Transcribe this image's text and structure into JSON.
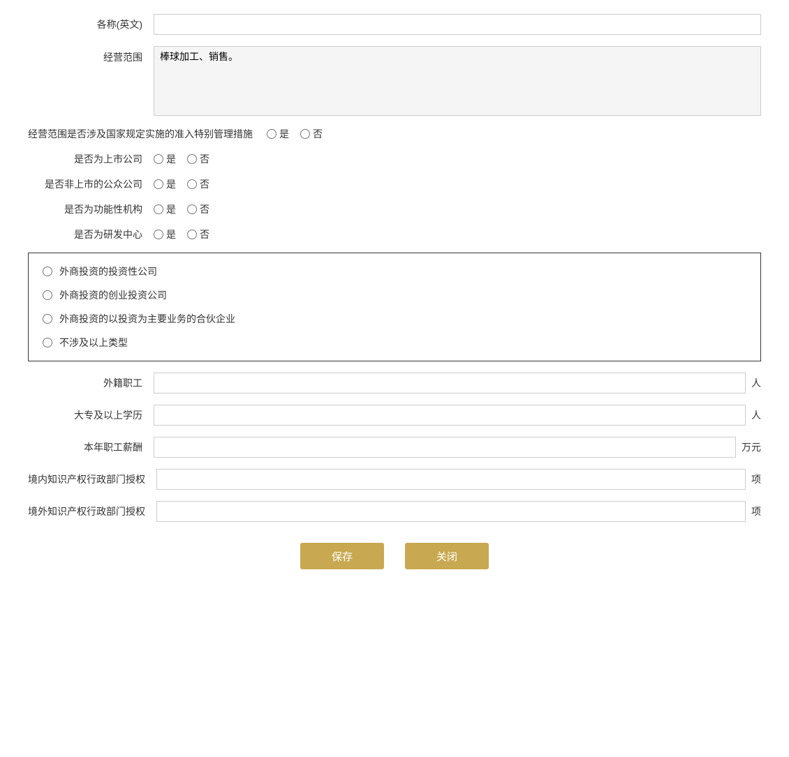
{
  "form": {
    "name_en_label": "各称(英文)",
    "name_en_value": "",
    "business_scope_label": "经营范围",
    "business_scope_value": "棒球加工、销售。",
    "special_mgmt_label": "经营范围是否涉及国家规定实施的准入特别管理措施",
    "is_label": "是",
    "no_label": "否",
    "listed_company_label": "是否为上市公司",
    "unlisted_public_label": "是否非上市的公众公司",
    "functional_org_label": "是否为功能性机构",
    "rd_center_label": "是否为研发中心",
    "investment_type_options": [
      "外商投资的投资性公司",
      "外商投资的创业投资公司",
      "外商投资的以投资为主要业务的合伙企业",
      "不涉及以上类型"
    ],
    "foreign_staff_label": "外籍职工",
    "foreign_staff_unit": "人",
    "foreign_staff_value": "",
    "college_above_label": "大专及以上学历",
    "college_above_unit": "人",
    "college_above_value": "",
    "annual_salary_label": "本年职工薪酬",
    "annual_salary_unit": "万元",
    "annual_salary_value": "",
    "domestic_ip_label": "境内知识产权行政部门授权",
    "domestic_ip_unit": "项",
    "domestic_ip_value": "",
    "foreign_ip_label": "境外知识产权行政部门授权",
    "foreign_ip_unit": "项",
    "foreign_ip_value": "",
    "save_btn": "保存",
    "close_btn": "关闭"
  }
}
